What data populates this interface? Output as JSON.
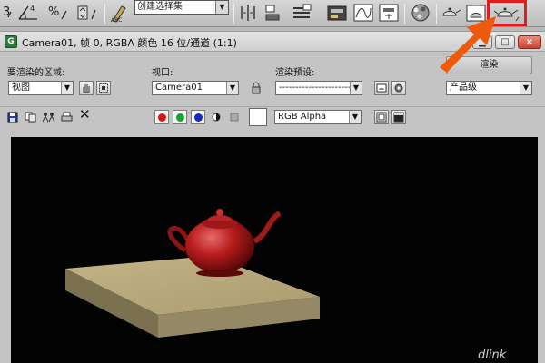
{
  "toolbar": {
    "selection_set": "创建选择集",
    "selection_set_prefix": "",
    "icons": [
      "snap-3-icon",
      "angle-snap-icon",
      "percent-snap-icon",
      "spinner-snap-icon",
      "edit-named-selection-icon",
      "mirror-icon",
      "align-icon",
      "layer-manager-icon",
      "graphite-ribbon-icon",
      "curve-editor-icon",
      "schematic-view-icon",
      "material-editor-icon",
      "render-setup-icon",
      "rendered-frame-window-icon",
      "render-production-icon"
    ],
    "highlight_color": "#e21b1b"
  },
  "window": {
    "title": "Camera01, 帧 0, RGBA 颜色 16 位/通道 (1:1)",
    "app_icon": "G",
    "area_label": "要渲染的区域:",
    "area_value": "视图",
    "viewport_label": "视口:",
    "viewport_value": "Camera01",
    "preset_label": "渲染预设:",
    "preset_value": "------------------------",
    "render_button": "渲染",
    "render_mode": "产品级",
    "channel_value": "RGB Alpha",
    "channel_colors": {
      "red": "#d81414",
      "green": "#15a328",
      "blue": "#1628c8"
    }
  },
  "watermark": "dlink"
}
